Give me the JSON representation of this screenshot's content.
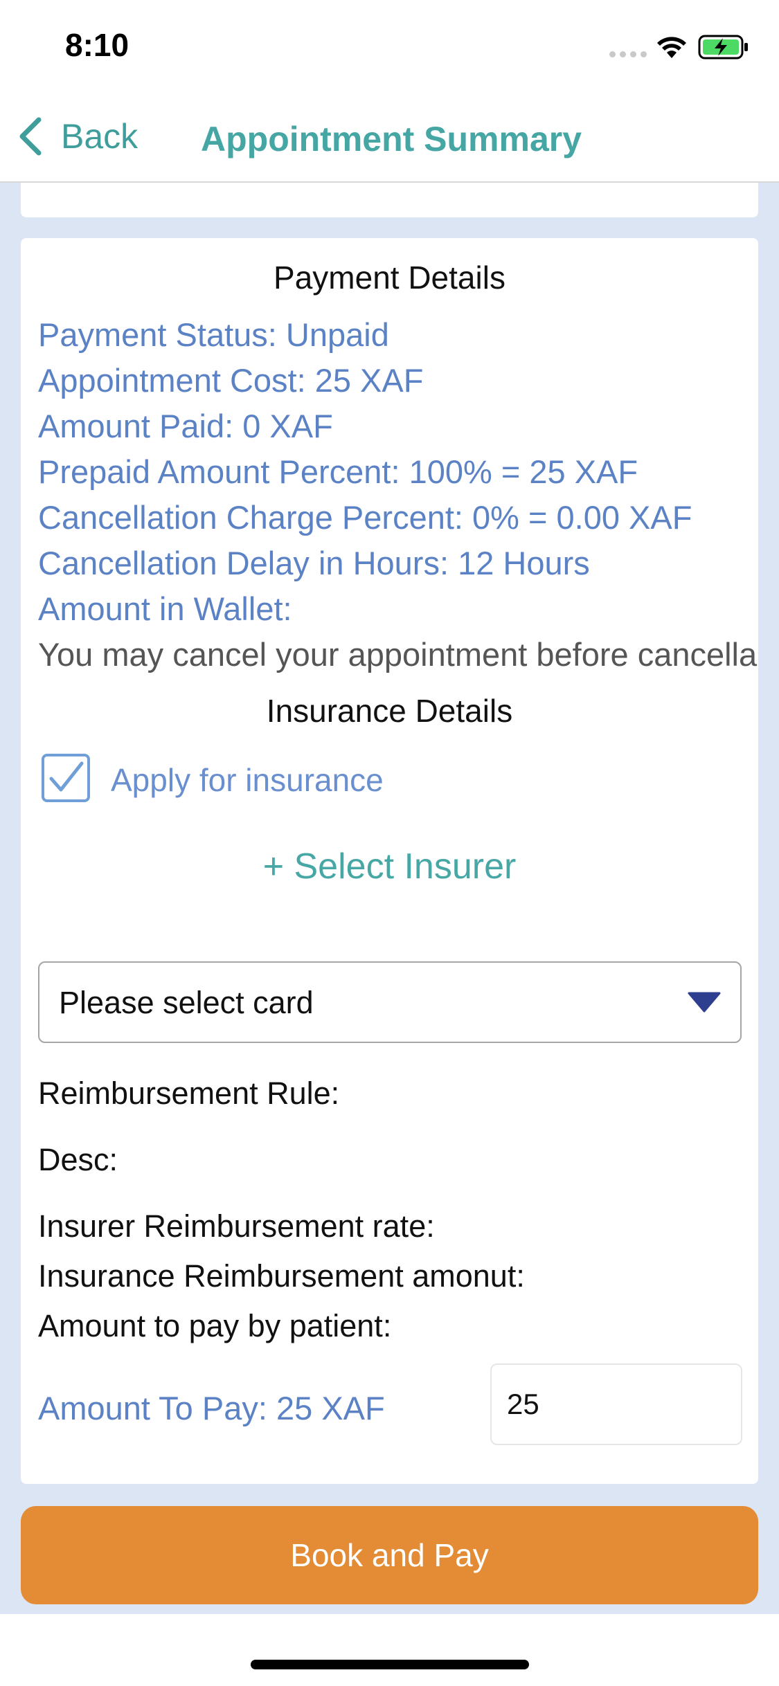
{
  "status_bar": {
    "time": "8:10"
  },
  "nav": {
    "back_label": "Back",
    "title": "Appointment Summary"
  },
  "payment": {
    "title": "Payment Details",
    "lines": [
      "Payment Status: Unpaid",
      "Appointment Cost: 25 XAF",
      "Amount Paid: 0 XAF",
      "Prepaid Amount Percent: 100% = 25 XAF",
      "Cancellation Charge Percent: 0% = 0.00 XAF",
      "Cancellation Delay in Hours: 12 Hours",
      "Amount in Wallet:"
    ],
    "notice": "You may cancel your appointment before cancella"
  },
  "insurance": {
    "title": "Insurance Details",
    "apply_label": "Apply for insurance",
    "apply_checked": true,
    "select_insurer": "+ Select Insurer",
    "card_select_value": "Please select card",
    "reimbursement_rule": "Reimbursement Rule:",
    "desc": "Desc:",
    "insurer_rate": "Insurer Reimbursement rate:",
    "insurance_amount": "Insurance Reimbursement amonut:",
    "patient_amount": "Amount to pay by patient:"
  },
  "amount": {
    "label": "Amount To Pay: 25 XAF",
    "input_value": "25"
  },
  "book_button": "Book and Pay",
  "colors": {
    "accent": "#45a6a4",
    "link_blue": "#5b82c5",
    "button_orange": "#e38c35",
    "background": "#dbe5f4"
  }
}
